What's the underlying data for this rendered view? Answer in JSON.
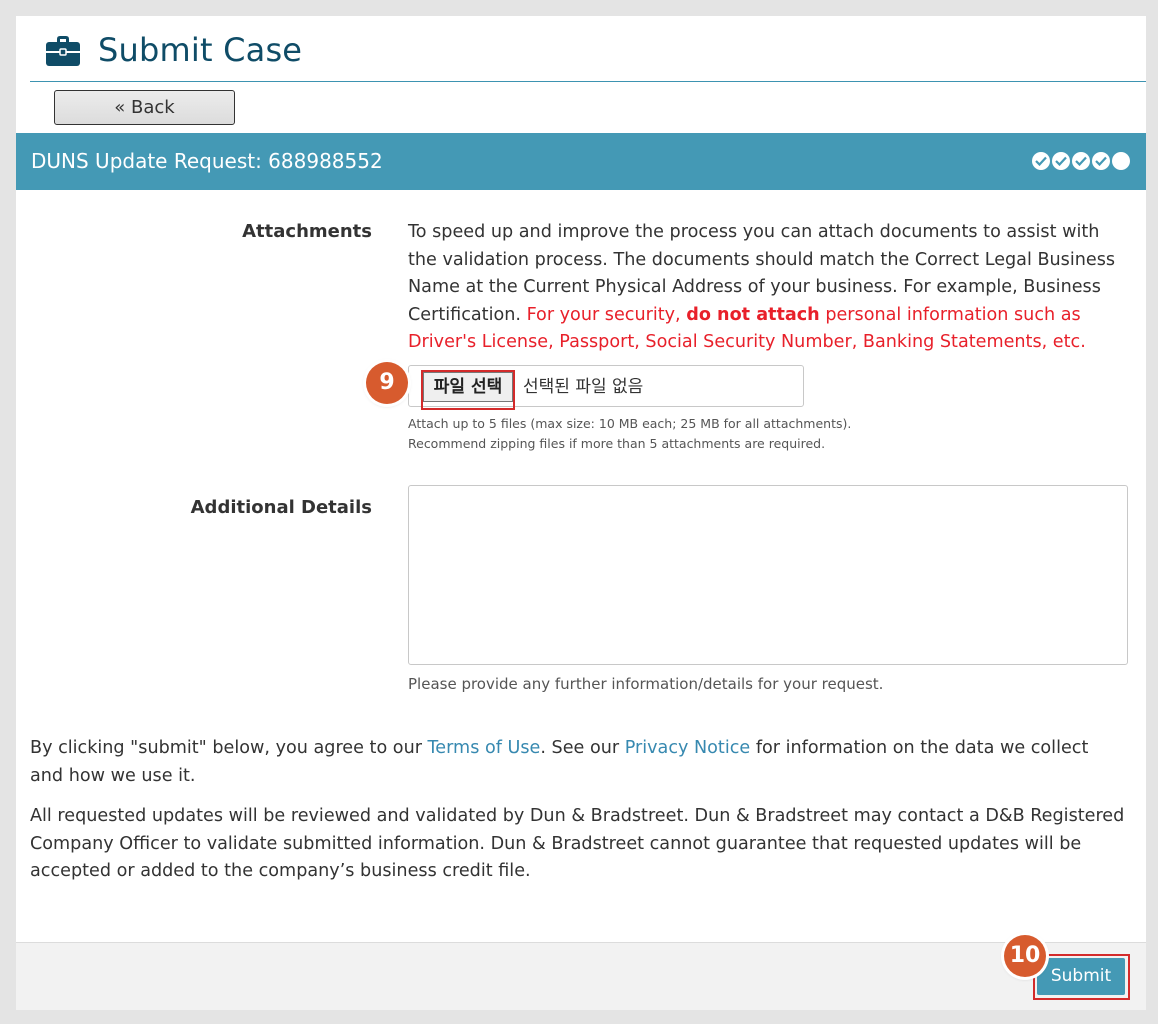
{
  "header": {
    "title": "Submit Case",
    "icon": "briefcase-icon"
  },
  "back_button": {
    "label": "« Back"
  },
  "banner": {
    "title": "DUNS Update Request: 688988552",
    "steps_completed": 4,
    "steps_total": 5
  },
  "attachments": {
    "label": "Attachments",
    "description": "To speed up and improve the process you can attach documents to assist with the validation process. The documents should match the Correct Legal Business Name at the Current Physical Address of your business. For example, Business Certification.",
    "warning_prefix": "For your security,",
    "warning_bold": "do not attach",
    "warning_suffix": "personal information such as Driver's License, Passport, Social Security Number, Banking Statements, etc.",
    "file_button_label": "파일 선택",
    "file_status": "선택된 파일 없음",
    "help_line_1": "Attach up to 5 files (max size: 10 MB each; 25 MB for all attachments).",
    "help_line_2": "Recommend zipping files if more than 5 attachments are required."
  },
  "additional_details": {
    "label": "Additional Details",
    "value": "",
    "help": "Please provide any further information/details for your request."
  },
  "agreement": {
    "prefix": "By clicking \"submit\" below, you agree to our",
    "terms_link": "Terms of Use",
    "middle": ". See our",
    "privacy_link": "Privacy Notice",
    "suffix": "for information on the data we collect and how we use it."
  },
  "review_note": "All requested updates will be reviewed and validated by Dun & Bradstreet. Dun & Bradstreet may contact a D&B Registered Company Officer to validate submitted information. Dun & Bradstreet cannot guarantee that requested updates will be accepted or added to the company’s business credit file.",
  "submit_button": {
    "label": "Submit"
  },
  "annotations": {
    "badge_file": "9",
    "badge_submit": "10"
  },
  "colors": {
    "brand_dark": "#0f4c67",
    "banner": "#4499b5",
    "warning": "#e8202a",
    "link": "#3789b0",
    "callout": "#d75b2e",
    "highlight": "#d32b2b"
  }
}
